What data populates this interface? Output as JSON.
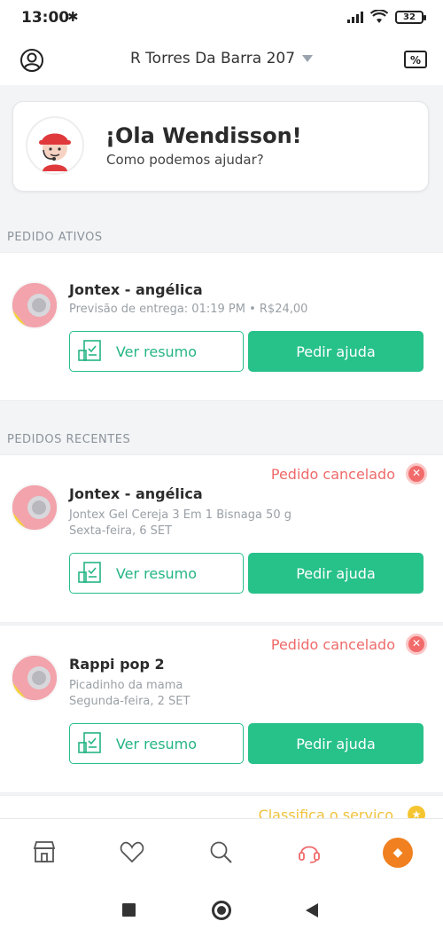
{
  "status_bar": {
    "time": "13:00",
    "battery": "32"
  },
  "header": {
    "address": "R Torres Da Barra 207"
  },
  "greeting": {
    "title": "¡Ola Wendisson!",
    "subtitle": "Como podemos ajudar?"
  },
  "active_section": {
    "title": "PEDIDO ATIVOS"
  },
  "active_order": {
    "store": "Jontex - angélica",
    "detail": "Previsão de entrega: 01:19 PM • R$24,00",
    "summary_label": "Ver resumo",
    "help_label": "Pedir ajuda"
  },
  "recent_section": {
    "title": "PEDIDOS RECENTES"
  },
  "recent_orders": [
    {
      "status": "Pedido cancelado",
      "store": "Jontex - angélica",
      "item": "Jontex Gel Cereja 3 Em 1 Bisnaga 50 g",
      "date": "Sexta-feira, 6 SET",
      "summary_label": "Ver resumo",
      "help_label": "Pedir ajuda"
    },
    {
      "status": "Pedido cancelado",
      "store": "Rappi pop 2",
      "item": "Picadinho da mama",
      "date": "Segunda-feira, 2 SET",
      "summary_label": "Ver resumo",
      "help_label": "Pedir ajuda"
    }
  ],
  "partial_card": {
    "rate_label": "Classifica o serviço"
  },
  "colors": {
    "accent": "#27c18a",
    "cancel": "#ef6a6a",
    "rate": "#f0c23c",
    "profile": "#f08020"
  }
}
